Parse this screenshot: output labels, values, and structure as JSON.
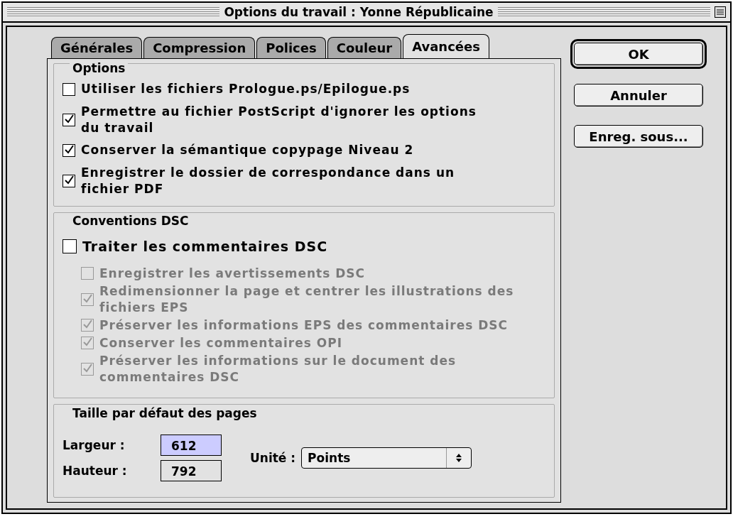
{
  "window": {
    "title": "Options du travail : Yonne Républicaine"
  },
  "tabs": [
    {
      "label": "Générales",
      "selected": false
    },
    {
      "label": "Compression",
      "selected": false
    },
    {
      "label": "Polices",
      "selected": false
    },
    {
      "label": "Couleur",
      "selected": false
    },
    {
      "label": "Avancées",
      "selected": true
    }
  ],
  "options": {
    "title": "Options",
    "items": [
      {
        "label": "Utiliser les fichiers Prologue.ps/Epilogue.ps",
        "checked": false,
        "disabled": false
      },
      {
        "label": "Permettre au fichier PostScript d'ignorer les options du travail",
        "checked": true,
        "disabled": false
      },
      {
        "label": "Conserver la sémantique copypage Niveau 2",
        "checked": true,
        "disabled": false
      },
      {
        "label": "Enregistrer le dossier de correspondance dans un fichier PDF",
        "checked": true,
        "disabled": false
      }
    ]
  },
  "dsc": {
    "title": "Conventions DSC",
    "items": [
      {
        "label": "Traiter les commentaires DSC",
        "checked": false,
        "disabled": false,
        "children": [
          {
            "label": "Enregistrer les avertissements DSC",
            "checked": false,
            "disabled": true
          },
          {
            "label": "Redimensionner la page et centrer les illustrations des fichiers EPS",
            "checked": true,
            "disabled": true
          },
          {
            "label": "Préserver les informations EPS des commentaires DSC",
            "checked": true,
            "disabled": true
          },
          {
            "label": "Conserver les commentaires OPI",
            "checked": true,
            "disabled": true
          },
          {
            "label": "Préserver les informations sur le document des commentaires DSC",
            "checked": true,
            "disabled": true
          }
        ]
      }
    ]
  },
  "page_size": {
    "title": "Taille par défaut des pages",
    "fields": [
      {
        "label": "Largeur :",
        "value": "612",
        "focused": true
      },
      {
        "label": "Hauteur :",
        "value": "792",
        "focused": false
      }
    ],
    "unit": {
      "label": "Unité :",
      "value": "Points"
    }
  },
  "buttons": [
    {
      "label": "OK",
      "default": true
    },
    {
      "label": "Annuler",
      "default": false
    },
    {
      "label": "Enreg. sous...",
      "default": false
    }
  ]
}
